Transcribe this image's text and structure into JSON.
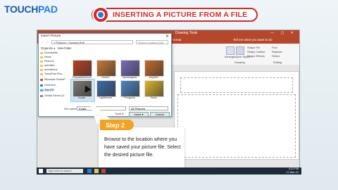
{
  "brand": {
    "logo_left": "TOUCH",
    "logo_right": "PAD"
  },
  "header": {
    "title": "INSERTING A PICTURE FROM A FILE"
  },
  "colors": {
    "accent": "#d12b2b",
    "step": "#f2a41f",
    "ppt": "#b7472a",
    "taskbar": "#1d2a38"
  },
  "ppt": {
    "title": "Drawing Tools",
    "tabs": [
      "File",
      "Home",
      "Insert",
      "Design",
      "Transitions",
      "Animations",
      "Slide Show",
      "Review",
      "View",
      "Format"
    ],
    "tell_me": "Tell me what you want to do",
    "ribbon_labels": {
      "drawing": "Drawing",
      "editing": "Editing",
      "find": "Find",
      "replace": "Replace",
      "select": "Select",
      "arrange": "Arrange",
      "quick_styles": "Quick Styles",
      "shape_fill": "Shape Fill",
      "shape_outline": "Shape Outline",
      "shape_effects": "Shape Effects"
    }
  },
  "dialog": {
    "title": "Insert Picture",
    "address": "« Pictures › Camera Roll",
    "search_placeholder": "Search Camera Roll",
    "toolbar": {
      "organize": "Organize ▾",
      "new_folder": "New folder"
    },
    "sidebar": [
      "Downloads",
      "music",
      "Pictures",
      "activities",
      "animations",
      "TouchPad Plus",
      "Microsoft PowerP",
      "OneDrive",
      "This PC",
      "Global Server (G"
    ],
    "thumbnails": [
      {
        "label": "Chrysanthemum",
        "color": "#b7411f"
      },
      {
        "label": "Desert",
        "color": "#c9782f"
      },
      {
        "label": "Hydrangeas",
        "color": "#7a6ac0"
      },
      {
        "label": "Jellyfish",
        "color": "#c56a2a"
      },
      {
        "label": "Koala",
        "color": "#7f7a70"
      },
      {
        "label": "Lighthouse",
        "color": "#3b6aa8"
      },
      {
        "label": "Penguins",
        "color": "#4a86c2"
      },
      {
        "label": "Tulips",
        "color": "#e0b52a"
      }
    ],
    "file_name_label": "File name:",
    "file_name_value": "Koala",
    "file_type": "All Pictures",
    "tools": "Tools ▾",
    "insert_btn": "Insert ▾",
    "cancel_btn": "Cancel"
  },
  "step": {
    "label": "Step 2",
    "text": "Browse to the location where you have saved your picture file. Select the desired picture file."
  },
  "taskbar": {
    "search_placeholder": "Type here to search",
    "time": "4:21 PM",
    "date": "17-Mar-21"
  }
}
